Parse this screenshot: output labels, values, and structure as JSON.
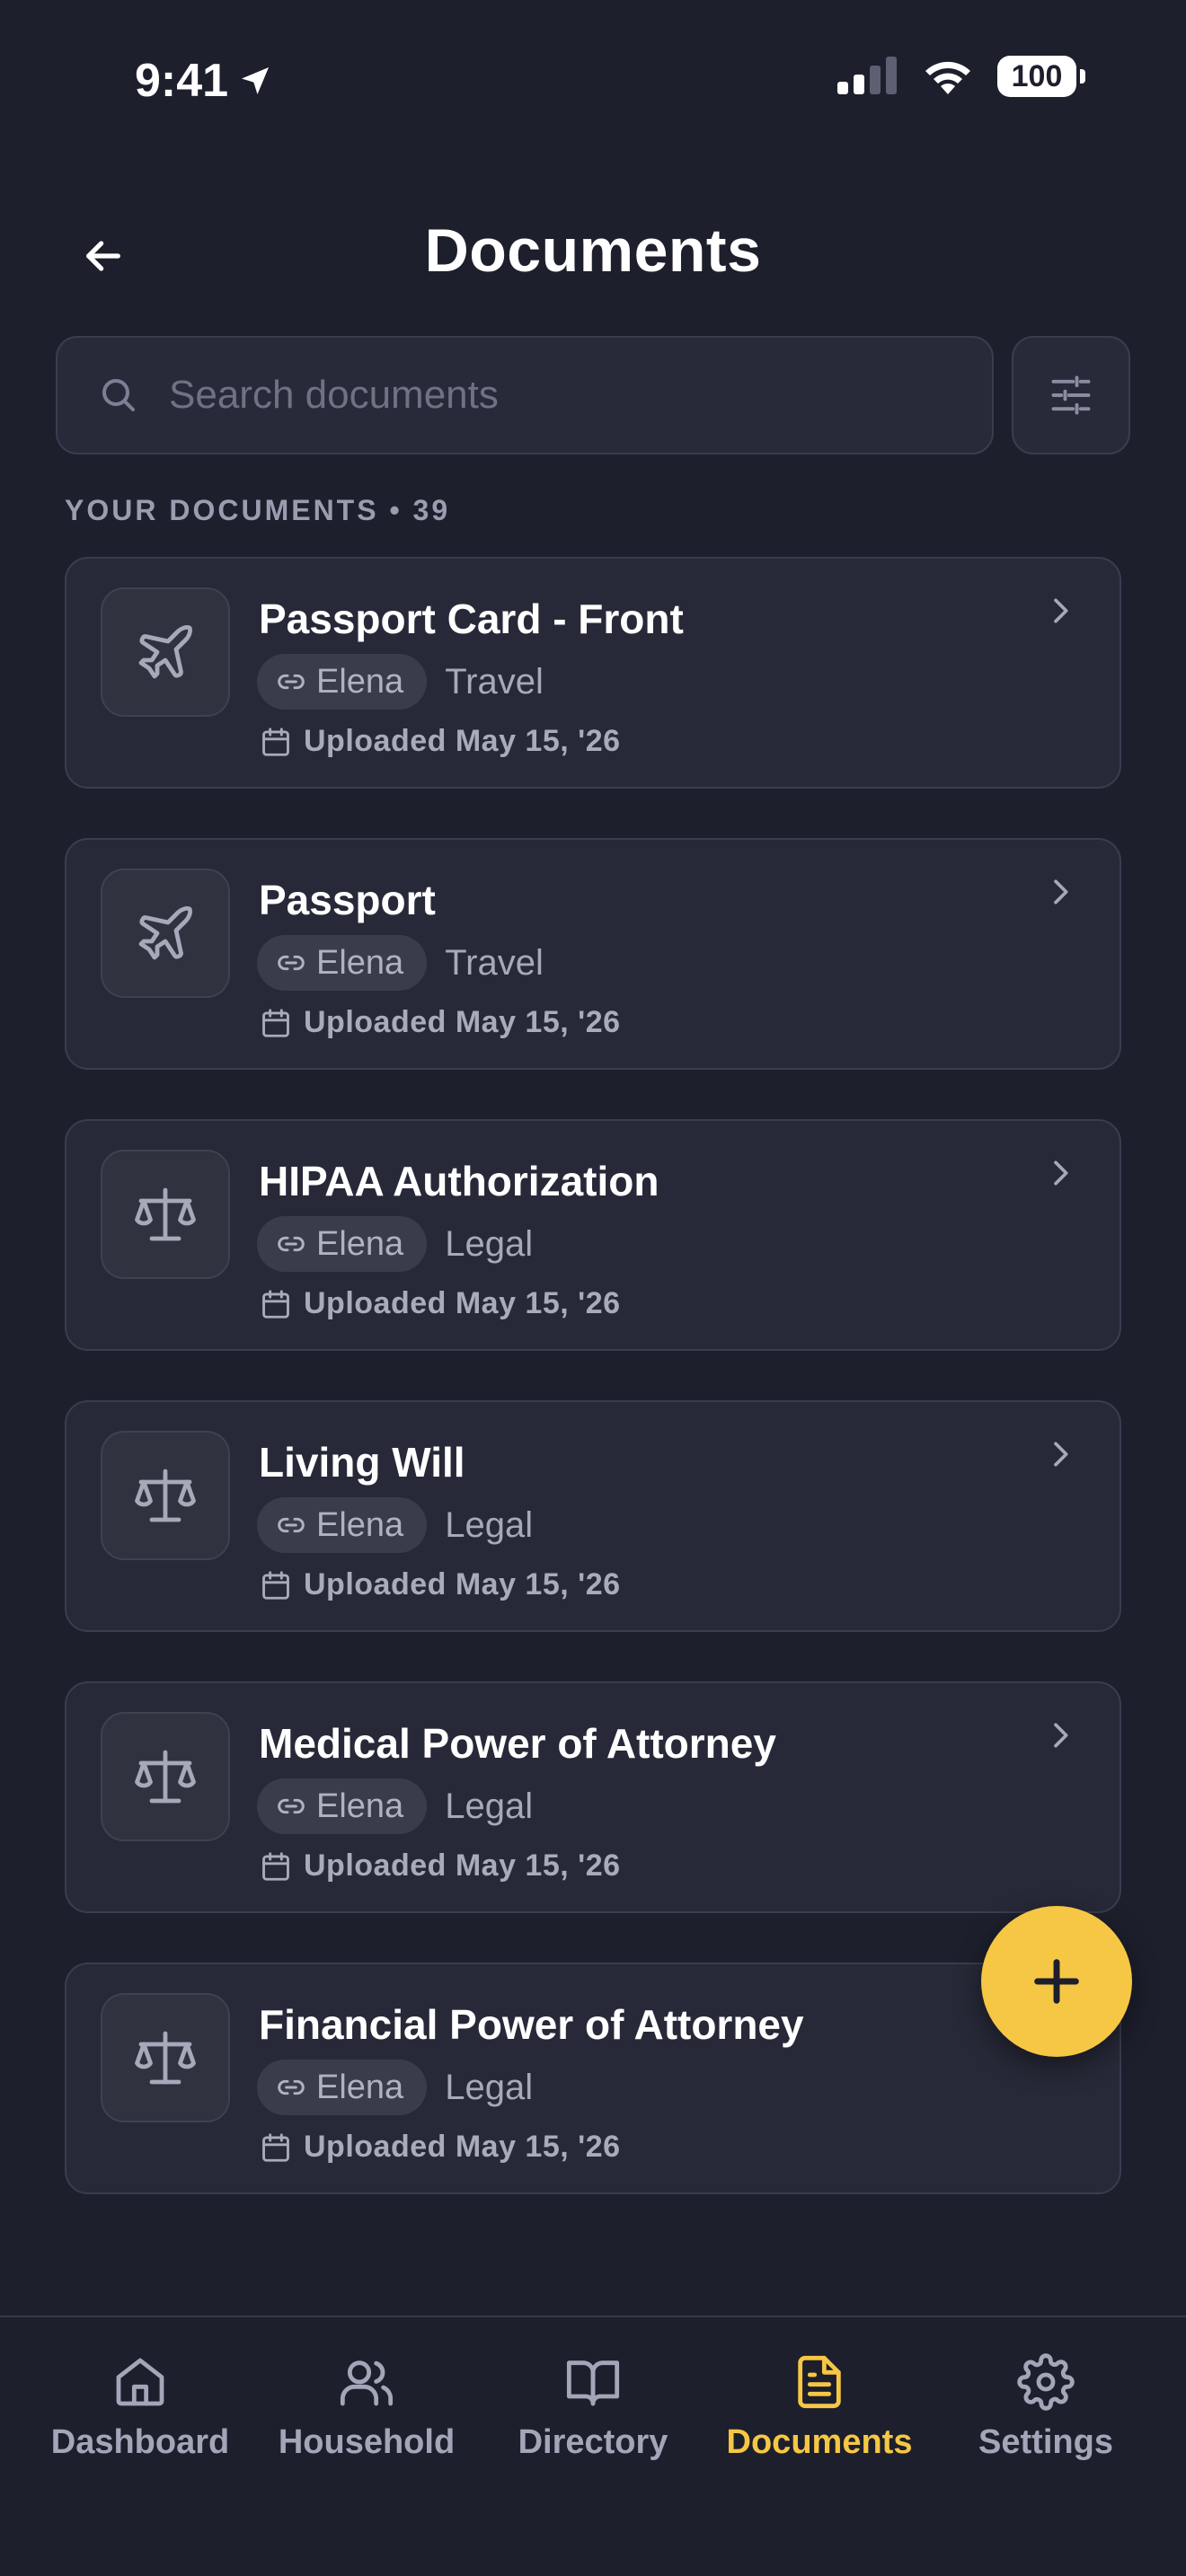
{
  "status_bar": {
    "time": "9:41",
    "battery": "100"
  },
  "header": {
    "title": "Documents"
  },
  "search": {
    "placeholder": "Search documents"
  },
  "section": {
    "label": "YOUR DOCUMENTS • 39"
  },
  "documents": [
    {
      "title": "Passport Card - Front",
      "owner": "Elena",
      "category": "Travel",
      "uploaded": "Uploaded May 15, '26",
      "icon": "airplane-icon"
    },
    {
      "title": "Passport",
      "owner": "Elena",
      "category": "Travel",
      "uploaded": "Uploaded May 15, '26",
      "icon": "airplane-icon"
    },
    {
      "title": "HIPAA Authorization",
      "owner": "Elena",
      "category": "Legal",
      "uploaded": "Uploaded May 15, '26",
      "icon": "scale-icon"
    },
    {
      "title": "Living Will",
      "owner": "Elena",
      "category": "Legal",
      "uploaded": "Uploaded May 15, '26",
      "icon": "scale-icon"
    },
    {
      "title": "Medical Power of Attorney",
      "owner": "Elena",
      "category": "Legal",
      "uploaded": "Uploaded May 15, '26",
      "icon": "scale-icon"
    },
    {
      "title": "Financial Power of Attorney",
      "owner": "Elena",
      "category": "Legal",
      "uploaded": "Uploaded May 15, '26",
      "icon": "scale-icon"
    }
  ],
  "nav": {
    "items": [
      {
        "label": "Dashboard",
        "icon": "home-icon"
      },
      {
        "label": "Household",
        "icon": "users-icon"
      },
      {
        "label": "Directory",
        "icon": "book-icon"
      },
      {
        "label": "Documents",
        "icon": "document-icon",
        "active": true
      },
      {
        "label": "Settings",
        "icon": "gear-icon"
      }
    ]
  },
  "colors": {
    "background": "#1d1f2c",
    "card": "#272938",
    "accent": "#f6c744",
    "muted": "#a3a6b8"
  }
}
